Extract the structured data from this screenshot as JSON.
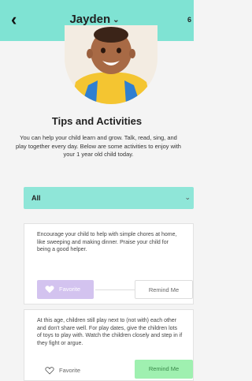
{
  "header": {
    "back_icon": "chevron-left-icon",
    "child_name": "Jayden",
    "dropdown_icon": "chevron-down-icon",
    "corner_text": "6"
  },
  "page": {
    "heading": "Tips and Activities",
    "intro": "You can help your child learn and grow. Talk, read, sing, and play together every day. Below are some activities to enjoy with your 1 year old child today."
  },
  "filter": {
    "selected": "All",
    "arrow_icon": "chevron-down-icon"
  },
  "activities": [
    {
      "text": "Encourage your child to help with simple chores at home, like sweeping and making dinner. Praise your child for being a good helper.",
      "favorite_label": "Favorite",
      "remind_label": "Remind Me",
      "favorited": true,
      "remind_active": false
    },
    {
      "text": "At this age, children still play next to (not with) each other and don't share well. For play dates, give the children lots of toys to play with. Watch the children closely and step in if they fight or argue.",
      "favorite_label": "Favorite",
      "remind_label": "Remind Me",
      "favorited": false,
      "remind_active": true
    }
  ],
  "colors": {
    "header": "#7fe3d3",
    "filter": "#8fe6d8",
    "favorite_active": "#d3c3ef",
    "remind_active": "#9ff0b0"
  }
}
